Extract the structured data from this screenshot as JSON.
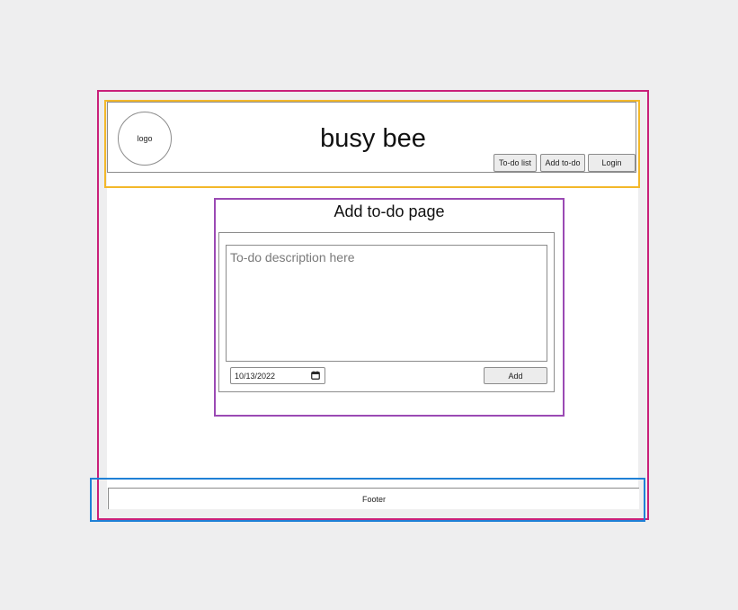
{
  "header": {
    "logo_label": "logo",
    "site_title": "busy bee",
    "nav": [
      {
        "label": "To-do list"
      },
      {
        "label": "Add to-do"
      },
      {
        "label": "Login"
      }
    ]
  },
  "main": {
    "page_title": "Add to-do page",
    "description_placeholder": "To-do description here",
    "date_value": "10/13/2022",
    "add_label": "Add"
  },
  "footer": {
    "label": "Footer"
  },
  "colors": {
    "outer_frame": "#c9207a",
    "header_highlight": "#f3b82a",
    "content_highlight": "#9b4ab4",
    "footer_highlight": "#1f80d6"
  },
  "icons": {
    "date_picker": "calendar-icon"
  }
}
